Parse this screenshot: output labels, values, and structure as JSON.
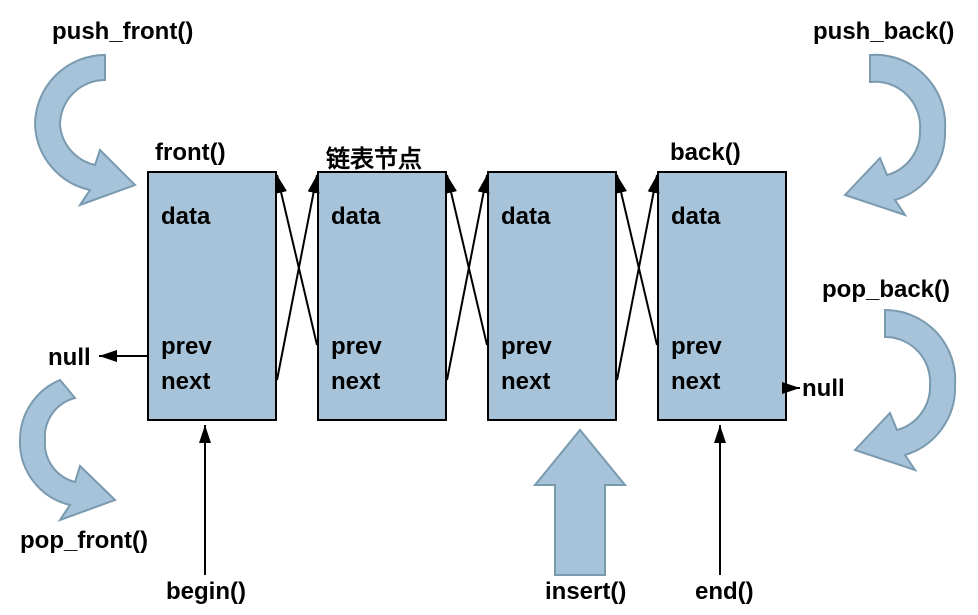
{
  "operations": {
    "push_front": "push_front()",
    "push_back": "push_back()",
    "pop_front": "pop_front()",
    "pop_back": "pop_back()",
    "front": "front()",
    "back": "back()",
    "begin": "begin()",
    "end": "end()",
    "insert": "insert()"
  },
  "labels": {
    "node_title": "链表节点",
    "null_left": "null",
    "null_right": "null"
  },
  "node_fields": {
    "data": "data",
    "prev": "prev",
    "next": "next"
  },
  "colors": {
    "node_fill": "#a6c3d9",
    "arrow_fill": "#a6c3d9",
    "arrow_stroke": "#7a9ab0"
  },
  "diagram": {
    "type": "doubly_linked_list",
    "node_count": 4,
    "left_terminator": "null",
    "right_terminator": "null"
  }
}
